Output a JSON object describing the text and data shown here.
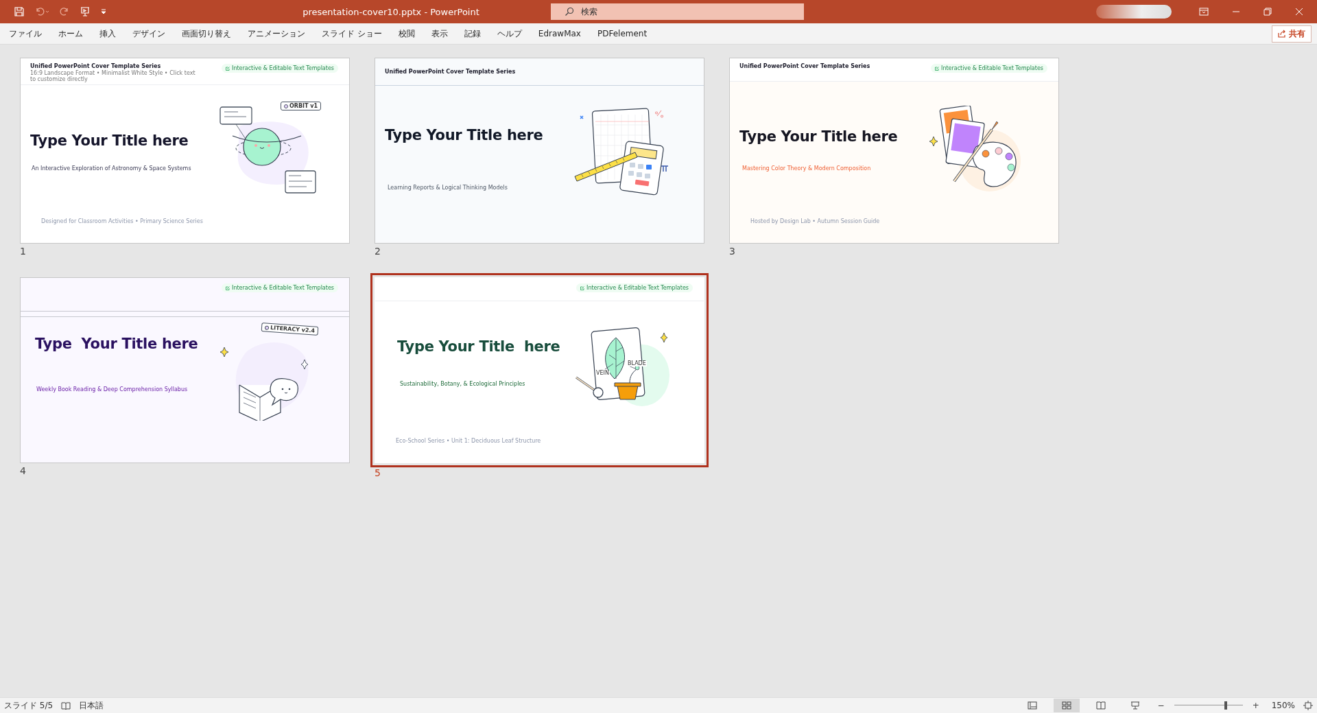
{
  "window": {
    "title": "presentation-cover10.pptx  -  PowerPoint",
    "search_placeholder": "検索"
  },
  "ribbon_tabs": [
    {
      "label": "ファイル"
    },
    {
      "label": "ホーム"
    },
    {
      "label": "挿入"
    },
    {
      "label": "デザイン"
    },
    {
      "label": "画面切り替え"
    },
    {
      "label": "アニメーション"
    },
    {
      "label": "スライド ショー"
    },
    {
      "label": "校閲"
    },
    {
      "label": "表示"
    },
    {
      "label": "記録"
    },
    {
      "label": "ヘルプ"
    },
    {
      "label": "EdrawMax"
    },
    {
      "label": "PDFelement"
    }
  ],
  "share_button": "共有",
  "slides": [
    {
      "number": "1",
      "selected": false,
      "kind": "planet",
      "header_title": "Unified PowerPoint Cover Template Series",
      "header_subtitle": "16:9 Landscape Format • Minimalist White Style • Click text to customize directly",
      "badge": "Interactive & Editable Text Templates",
      "title": "Type Your Title here",
      "subtitle": "An Interactive Exploration of Astronomy & Space Systems",
      "footer": "Designed for Classroom Activities • Primary Science Series",
      "tag": "ORBIT v1"
    },
    {
      "number": "2",
      "selected": false,
      "kind": "math",
      "header_title": "Unified PowerPoint Cover Template Series",
      "title": "Type Your Title here",
      "subtitle": "Learning Reports & Logical Thinking Models"
    },
    {
      "number": "3",
      "selected": false,
      "kind": "palette",
      "header_title": "Unified PowerPoint Cover Template Series",
      "badge": "Interactive & Editable Text Templates",
      "title": "Type Your Title here",
      "subtitle": "Mastering Color Theory & Modern Composition",
      "footer": "Hosted by Design Lab • Autumn Session Guide"
    },
    {
      "number": "4",
      "selected": false,
      "kind": "book",
      "badge": "Interactive & Editable Text Templates",
      "title": "Type  Your Title here",
      "subtitle": "Weekly Book Reading & Deep Comprehension Syllabus",
      "tag": "LITERACY v2.4"
    },
    {
      "number": "5",
      "selected": true,
      "kind": "leaf",
      "badge": "Interactive & Editable Text Templates",
      "title": "Type Your Title  here",
      "subtitle": "Sustainability, Botany, & Ecological Principles",
      "footer": "Eco-School Series • Unit 1: Deciduous Leaf Structure",
      "labels": [
        "VEIN",
        "BLADE"
      ]
    }
  ],
  "status_bar": {
    "slide_indicator": "スライド 5/5",
    "language": "日本語",
    "views": [
      {
        "selected": false
      },
      {
        "selected": true
      },
      {
        "selected": false
      },
      {
        "selected": false
      }
    ],
    "zoom_minus": "−",
    "zoom_plus": "+",
    "zoom": {
      "level": 0.75
    },
    "zoom_percent": "150%"
  }
}
